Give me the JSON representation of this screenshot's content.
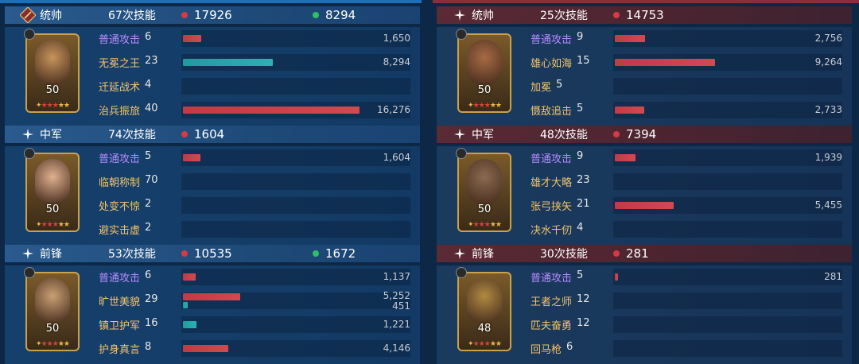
{
  "left": {
    "sections": [
      {
        "role": "统帅",
        "skills": "67次技能",
        "damage": "17926",
        "heal": "8294",
        "level": "50",
        "rows": [
          {
            "name": "普通攻击",
            "lv": "6",
            "type": "basic",
            "damage": 1650,
            "heal": null,
            "damage_text": "1,650",
            "heal_text": ""
          },
          {
            "name": "无冕之王",
            "lv": "23",
            "type": "skill",
            "damage": null,
            "heal": 8294,
            "damage_text": "8,294",
            "heal_text": ""
          },
          {
            "name": "迁延战术",
            "lv": "4",
            "type": "skill",
            "damage": null,
            "heal": null,
            "damage_text": "",
            "heal_text": ""
          },
          {
            "name": "治兵振旅",
            "lv": "40",
            "type": "skill",
            "damage": 16276,
            "heal": null,
            "damage_text": "16,276",
            "heal_text": ""
          }
        ]
      },
      {
        "role": "中军",
        "skills": "74次技能",
        "damage": "1604",
        "heal": "",
        "level": "50",
        "rows": [
          {
            "name": "普通攻击",
            "lv": "5",
            "type": "basic",
            "damage": 1604,
            "heal": null,
            "damage_text": "1,604",
            "heal_text": ""
          },
          {
            "name": "临朝称制",
            "lv": "70",
            "type": "skill",
            "damage": null,
            "heal": null,
            "damage_text": "",
            "heal_text": ""
          },
          {
            "name": "处变不惊",
            "lv": "2",
            "type": "skill",
            "damage": null,
            "heal": null,
            "damage_text": "",
            "heal_text": ""
          },
          {
            "name": "避实击虚",
            "lv": "2",
            "type": "skill",
            "damage": null,
            "heal": null,
            "damage_text": "",
            "heal_text": ""
          }
        ]
      },
      {
        "role": "前锋",
        "skills": "53次技能",
        "damage": "10535",
        "heal": "1672",
        "level": "50",
        "rows": [
          {
            "name": "普通攻击",
            "lv": "6",
            "type": "basic",
            "damage": 1137,
            "heal": null,
            "damage_text": "1,137",
            "heal_text": ""
          },
          {
            "name": "旷世美貌",
            "lv": "29",
            "type": "skill",
            "damage": 5252,
            "heal": 451,
            "damage_text": "5,252",
            "heal_text": "451"
          },
          {
            "name": "镇卫护军",
            "lv": "16",
            "type": "skill",
            "damage": null,
            "heal": 1221,
            "damage_text": "1,221",
            "heal_text": ""
          },
          {
            "name": "护身真言",
            "lv": "8",
            "type": "skill",
            "damage": 4146,
            "heal": null,
            "damage_text": "4,146",
            "heal_text": ""
          }
        ]
      }
    ]
  },
  "right": {
    "sections": [
      {
        "role": "统帅",
        "skills": "25次技能",
        "damage": "14753",
        "heal": "",
        "level": "50",
        "rows": [
          {
            "name": "普通攻击",
            "lv": "9",
            "type": "basic",
            "damage": 2756,
            "heal": null,
            "damage_text": "2,756",
            "heal_text": ""
          },
          {
            "name": "雄心如海",
            "lv": "15",
            "type": "skill",
            "damage": 9264,
            "heal": null,
            "damage_text": "9,264",
            "heal_text": ""
          },
          {
            "name": "加冕",
            "lv": "5",
            "type": "skill",
            "damage": null,
            "heal": null,
            "damage_text": "",
            "heal_text": ""
          },
          {
            "name": "慑敌追击",
            "lv": "5",
            "type": "skill",
            "damage": 2733,
            "heal": null,
            "damage_text": "2,733",
            "heal_text": ""
          }
        ]
      },
      {
        "role": "中军",
        "skills": "48次技能",
        "damage": "7394",
        "heal": "",
        "level": "50",
        "rows": [
          {
            "name": "普通攻击",
            "lv": "9",
            "type": "basic",
            "damage": 1939,
            "heal": null,
            "damage_text": "1,939",
            "heal_text": ""
          },
          {
            "name": "雄才大略",
            "lv": "23",
            "type": "skill",
            "damage": null,
            "heal": null,
            "damage_text": "",
            "heal_text": ""
          },
          {
            "name": "张弓挟矢",
            "lv": "21",
            "type": "skill",
            "damage": 5455,
            "heal": null,
            "damage_text": "5,455",
            "heal_text": ""
          },
          {
            "name": "决水千仞",
            "lv": "4",
            "type": "skill",
            "damage": null,
            "heal": null,
            "damage_text": "",
            "heal_text": ""
          }
        ]
      },
      {
        "role": "前锋",
        "skills": "30次技能",
        "damage": "281",
        "heal": "",
        "level": "48",
        "rows": [
          {
            "name": "普通攻击",
            "lv": "5",
            "type": "basic",
            "damage": 281,
            "heal": null,
            "damage_text": "281",
            "heal_text": ""
          },
          {
            "name": "王者之师",
            "lv": "12",
            "type": "skill",
            "damage": null,
            "heal": null,
            "damage_text": "",
            "heal_text": ""
          },
          {
            "name": "匹夫奋勇",
            "lv": "12",
            "type": "skill",
            "damage": null,
            "heal": null,
            "damage_text": "",
            "heal_text": ""
          },
          {
            "name": "回马枪",
            "lv": "6",
            "type": "skill",
            "damage": null,
            "heal": null,
            "damage_text": "",
            "heal_text": ""
          }
        ]
      }
    ]
  },
  "colors": {
    "damage_dot": "#d63a46",
    "heal_dot": "#2fbf6a",
    "basic_attack": "#b58cff",
    "skill_name": "#f3c46a",
    "damage_bar": "#c23a44",
    "heal_bar": "#2ab2b4"
  },
  "icons": {
    "commander": "sword-badge-icon",
    "role": "sparkle-icon",
    "cavalry": "horse-icon",
    "damage": "red-dot-icon",
    "heal": "green-dot-icon"
  }
}
